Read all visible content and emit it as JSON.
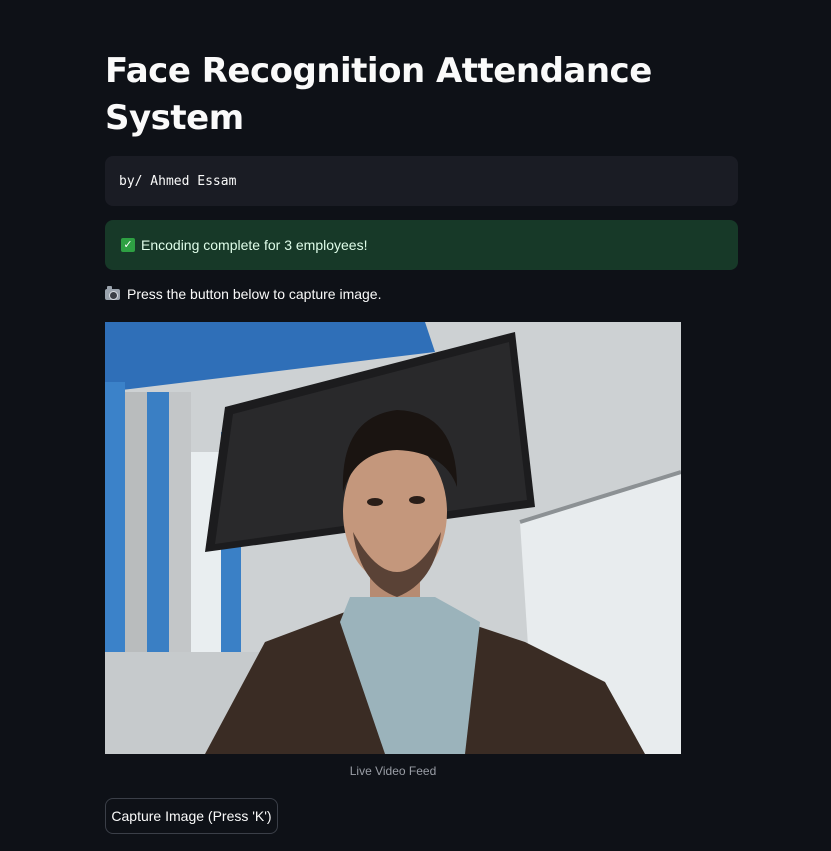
{
  "header": {
    "title": "Face Recognition Attendance System"
  },
  "author": {
    "code_text": "by/ Ahmed Essam"
  },
  "status": {
    "icon": "check-icon",
    "message": "Encoding complete for 3 employees!",
    "background_color": "#173928"
  },
  "prompt": {
    "icon": "camera-icon",
    "text": "Press the button below to capture image."
  },
  "video": {
    "caption": "Live Video Feed"
  },
  "actions": {
    "capture_label": "Capture Image (Press 'K')"
  }
}
